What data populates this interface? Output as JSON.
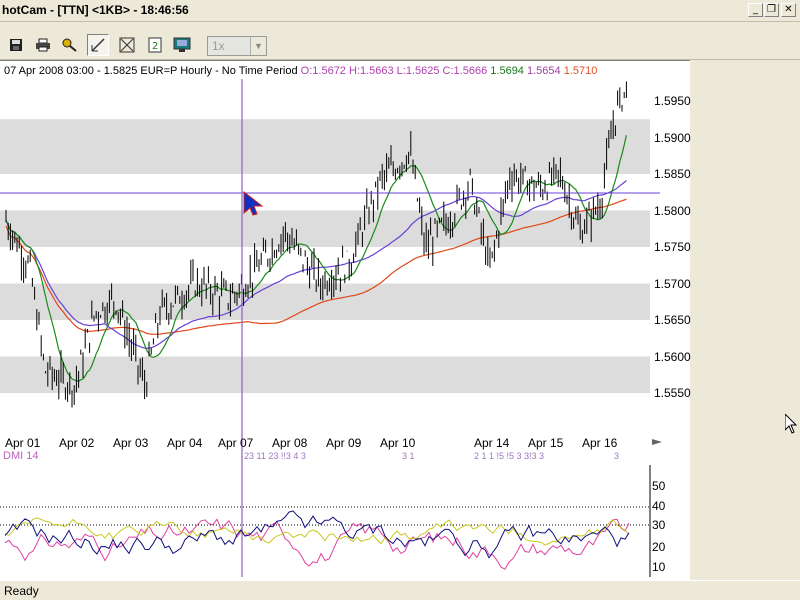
{
  "window": {
    "title": "hotCam - [TTN] <1KB> - 18:46:56",
    "controls": [
      "_",
      "❐",
      "✕"
    ]
  },
  "toolbar": {
    "zoom_value": "1x",
    "buttons": [
      {
        "name": "save-icon",
        "glyph": "💾"
      },
      {
        "name": "print-icon",
        "glyph": "🖨"
      },
      {
        "name": "key-icon",
        "glyph": "🔑"
      },
      {
        "name": "draw-line-icon",
        "glyph": "✎"
      },
      {
        "name": "fit-icon",
        "glyph": "⤢"
      },
      {
        "name": "page-icon",
        "glyph": "2"
      },
      {
        "name": "monitor-icon",
        "glyph": "▣"
      }
    ]
  },
  "chart": {
    "header": {
      "prefix": "07 Apr 2008 03:00 - 1.5825 EUR=P Hourly - No Time Period",
      "ohlc": "O:1.5672 H:1.5663 L:1.5625 C:1.5666",
      "val_green": "1.5694",
      "val_purple": "1.5654",
      "val_red": "1.5710"
    },
    "y_labels": [
      "1.5950",
      "1.5900",
      "1.5850",
      "1.5800",
      "1.5750",
      "1.5700",
      "1.5650",
      "1.5600",
      "1.5550"
    ],
    "x_labels": [
      "Apr 01",
      "Apr 02",
      "Apr 03",
      "Apr 04",
      "Apr 07",
      "Apr 08",
      "Apr 09",
      "Apr 10",
      "Apr 14",
      "Apr 15",
      "Apr 16"
    ],
    "dmi_label": "DMI 14",
    "osc_labels": [
      "50",
      "40",
      "30",
      "20",
      "10"
    ],
    "trade_marks": "23 11 23 !!3 4 3",
    "trade_marks_2": "3 1",
    "trade_marks_3": "2 1 1 !5 !5 3 3!3 3",
    "trade_marks_4": "3",
    "colors": {
      "price": "#000000",
      "ma_green": "#1a8a1a",
      "ma_purple": "#6a40d8",
      "ma_red": "#e04818",
      "crosshair": "#9060c0",
      "band": "#dcdcdc"
    }
  },
  "status": {
    "text": "Ready"
  }
}
